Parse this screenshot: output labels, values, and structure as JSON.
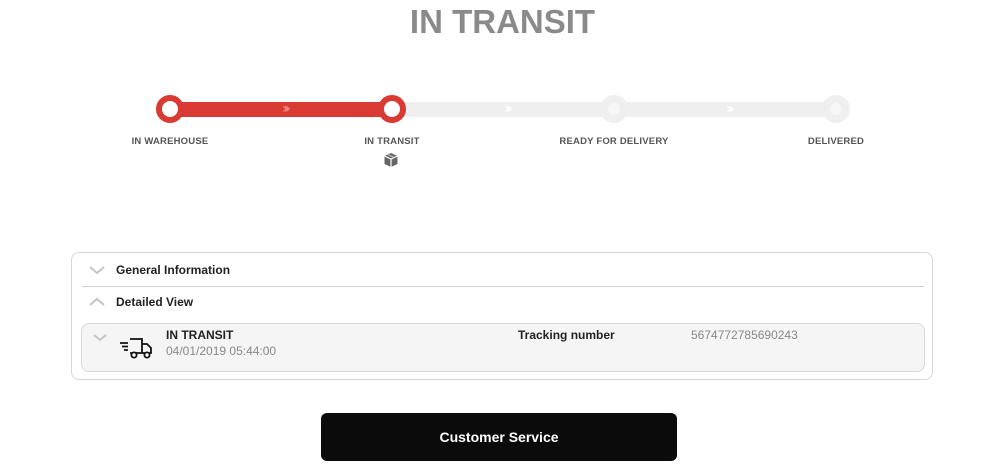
{
  "page": {
    "title": "IN TRANSIT"
  },
  "tracker": {
    "steps": [
      {
        "label": "IN WAREHOUSE",
        "state": "done"
      },
      {
        "label": "IN TRANSIT",
        "state": "current"
      },
      {
        "label": "READY FOR DELIVERY",
        "state": "pending"
      },
      {
        "label": "DELIVERED",
        "state": "pending"
      }
    ],
    "active_color": "#d93a33",
    "inactive_color": "#efefef",
    "current_icon": "package-icon"
  },
  "details": {
    "general_label": "General Information",
    "detailed_label": "Detailed View",
    "event": {
      "status": "IN TRANSIT",
      "timestamp": "04/01/2019 05:44:00",
      "tracking_label": "Tracking number",
      "tracking_number": "5674772785690243",
      "icon": "delivery-truck-icon"
    }
  },
  "actions": {
    "customer_service_label": "Customer Service"
  }
}
